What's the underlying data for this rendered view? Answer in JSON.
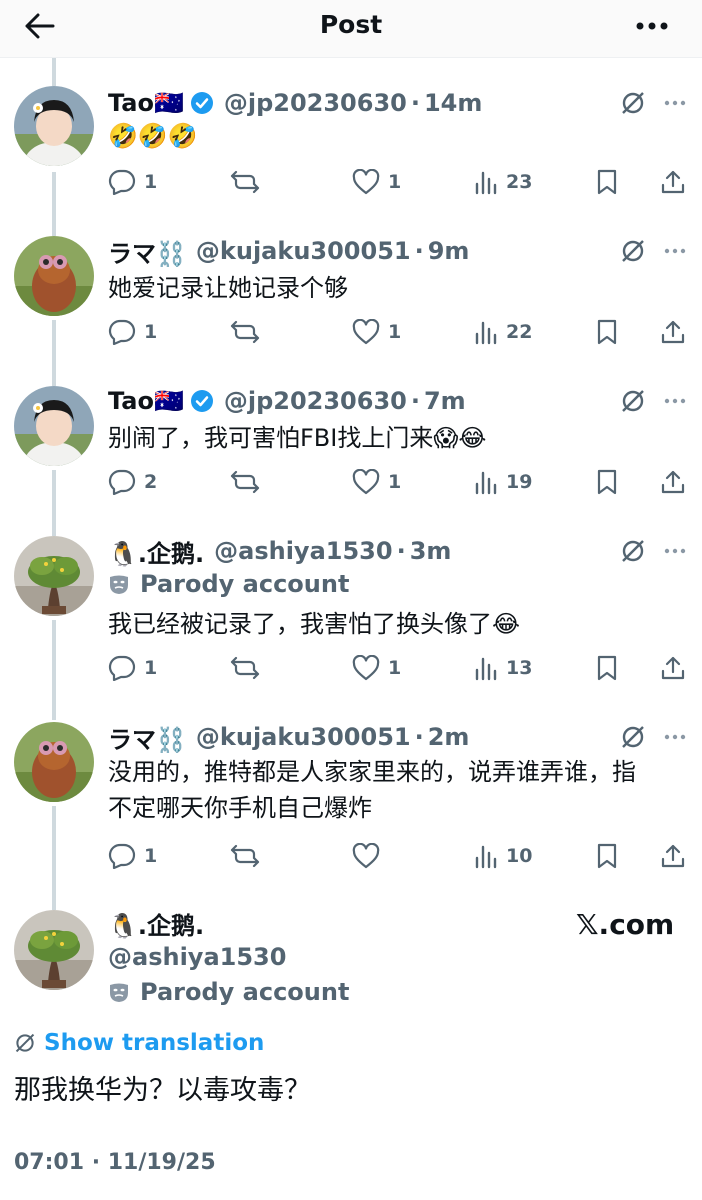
{
  "header": {
    "title": "Post"
  },
  "replies": [
    {
      "name": "Tao🇦🇺",
      "verified": true,
      "handle": "@jp20230630",
      "time": "14m",
      "parody": "",
      "text": "🤣🤣🤣",
      "stats": {
        "replies": "1",
        "reposts": "",
        "likes": "1",
        "views": "23"
      }
    },
    {
      "name": "ラマ⛓️",
      "verified": false,
      "handle": "@kujaku300051",
      "time": "9m",
      "parody": "",
      "text": "她爱记录让她记录个够",
      "stats": {
        "replies": "1",
        "reposts": "",
        "likes": "1",
        "views": "22"
      }
    },
    {
      "name": "Tao🇦🇺",
      "verified": true,
      "handle": "@jp20230630",
      "time": "7m",
      "parody": "",
      "text": "别闹了，我可害怕FBI找上门来😱😂",
      "stats": {
        "replies": "2",
        "reposts": "",
        "likes": "1",
        "views": "19"
      }
    },
    {
      "name": "🐧.企鹅.",
      "verified": false,
      "handle": "@ashiya1530",
      "time": "3m",
      "parody": "Parody account",
      "text": "我已经被记录了，我害怕了换头像了😂",
      "stats": {
        "replies": "1",
        "reposts": "",
        "likes": "1",
        "views": "13"
      }
    },
    {
      "name": "ラマ⛓️",
      "verified": false,
      "handle": "@kujaku300051",
      "time": "2m",
      "parody": "",
      "text": "没用的，推特都是人家家里来的，说弄谁弄谁，指不定哪天你手机自己爆炸",
      "stats": {
        "replies": "1",
        "reposts": "",
        "likes": "",
        "views": "10"
      }
    }
  ],
  "main_post": {
    "name": "🐧.企鹅.",
    "handle": "@ashiya1530",
    "parody": "Parody account",
    "watermark": "𝕏.com",
    "show_translation": "Show translation",
    "text": "那我换华为？以毒攻毒？",
    "timestamp": "07:01 · 11/19/25"
  },
  "colors": {
    "text": "#0f1419",
    "secondary": "#536471",
    "link": "#1d9bf0",
    "verified": "#1d9bf0",
    "thread_line": "#cfd9de"
  },
  "icons": [
    "back-arrow-icon",
    "more-icon",
    "verified-badge-icon",
    "translate-icon",
    "reply-icon",
    "repost-icon",
    "like-icon",
    "views-icon",
    "bookmark-icon",
    "share-icon",
    "parody-mask-icon"
  ]
}
